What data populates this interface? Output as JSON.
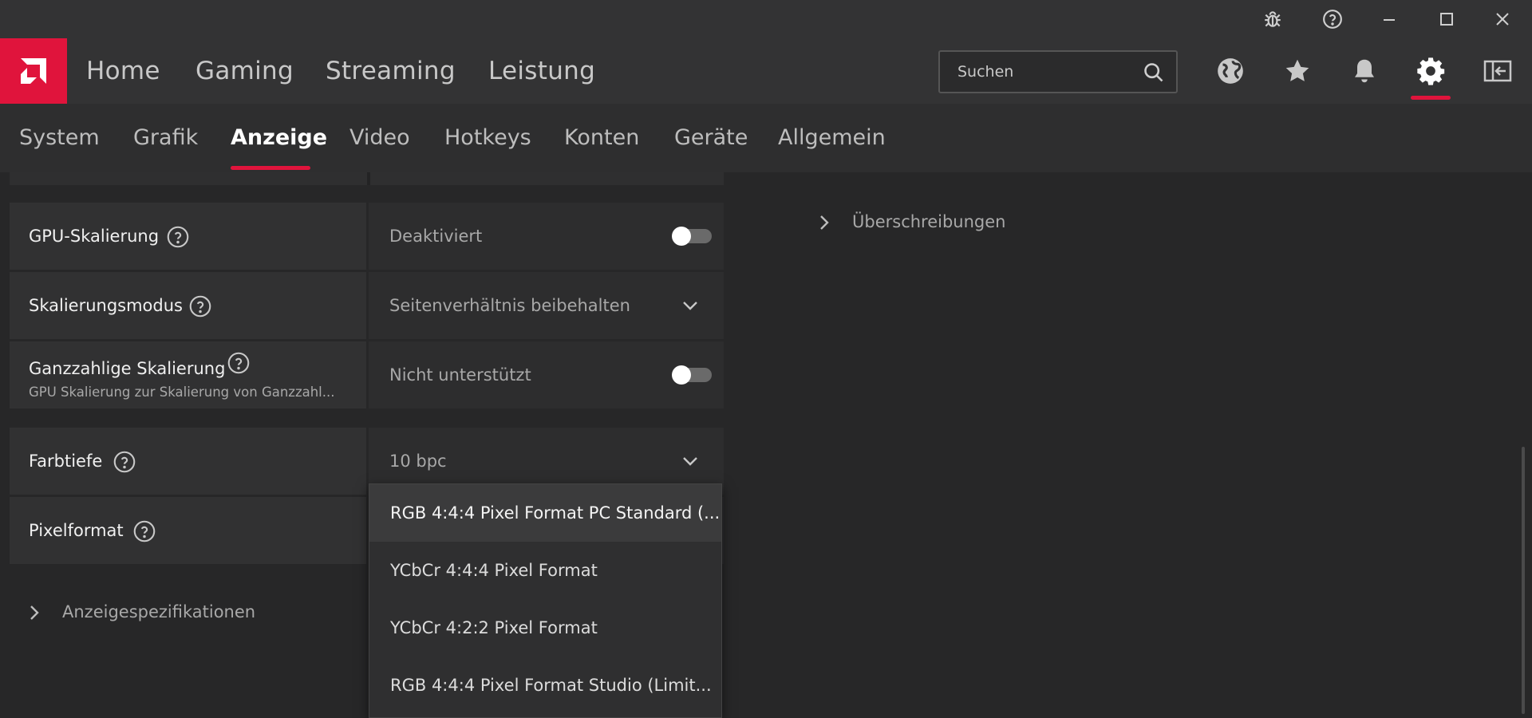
{
  "titlebar": {
    "icons": [
      "bug-icon",
      "help-circle-icon",
      "minimize-icon",
      "maximize-icon",
      "close-icon"
    ]
  },
  "brand": {
    "accent": "#e0143c",
    "logo_icon": "amd-logo-icon"
  },
  "mainnav": {
    "items": [
      {
        "label": "Home"
      },
      {
        "label": "Gaming"
      },
      {
        "label": "Streaming"
      },
      {
        "label": "Leistung"
      }
    ],
    "search": {
      "placeholder": "Suchen",
      "value": ""
    },
    "icons": [
      "globe-icon",
      "star-icon",
      "bell-icon",
      "gear-icon",
      "sidebar-toggle-icon"
    ],
    "active_icon": "gear-icon"
  },
  "subnav": {
    "items": [
      {
        "label": "System"
      },
      {
        "label": "Grafik"
      },
      {
        "label": "Anzeige"
      },
      {
        "label": "Video"
      },
      {
        "label": "Hotkeys"
      },
      {
        "label": "Konten"
      },
      {
        "label": "Geräte"
      },
      {
        "label": "Allgemein"
      }
    ],
    "active": "Anzeige"
  },
  "settings": {
    "gpu_scaling": {
      "label": "GPU-Skalierung",
      "value": "Deaktiviert",
      "enabled": false
    },
    "scaling_mode": {
      "label": "Skalierungsmodus",
      "value": "Seitenverhältnis beibehalten"
    },
    "integer_scaling": {
      "label": "Ganzzahlige Skalierung",
      "description": "GPU Skalierung zur Skalierung von Ganzzahl...",
      "value": "Nicht unterstützt",
      "enabled": false
    },
    "color_depth": {
      "label": "Farbtiefe",
      "value": "10 bpc"
    },
    "pixel_format": {
      "label": "Pixelformat"
    }
  },
  "expanders": {
    "display_specs": "Anzeigespezifikationen",
    "overrides": "Überschreibungen"
  },
  "pixel_format_dropdown": {
    "options": [
      {
        "label": "RGB 4:4:4 Pixel Format PC Standard (...",
        "selected": true
      },
      {
        "label": "YCbCr 4:4:4 Pixel Format",
        "selected": false
      },
      {
        "label": "YCbCr 4:2:2 Pixel Format",
        "selected": false
      },
      {
        "label": "RGB 4:4:4 Pixel Format Studio (Limit...",
        "selected": false
      }
    ]
  }
}
